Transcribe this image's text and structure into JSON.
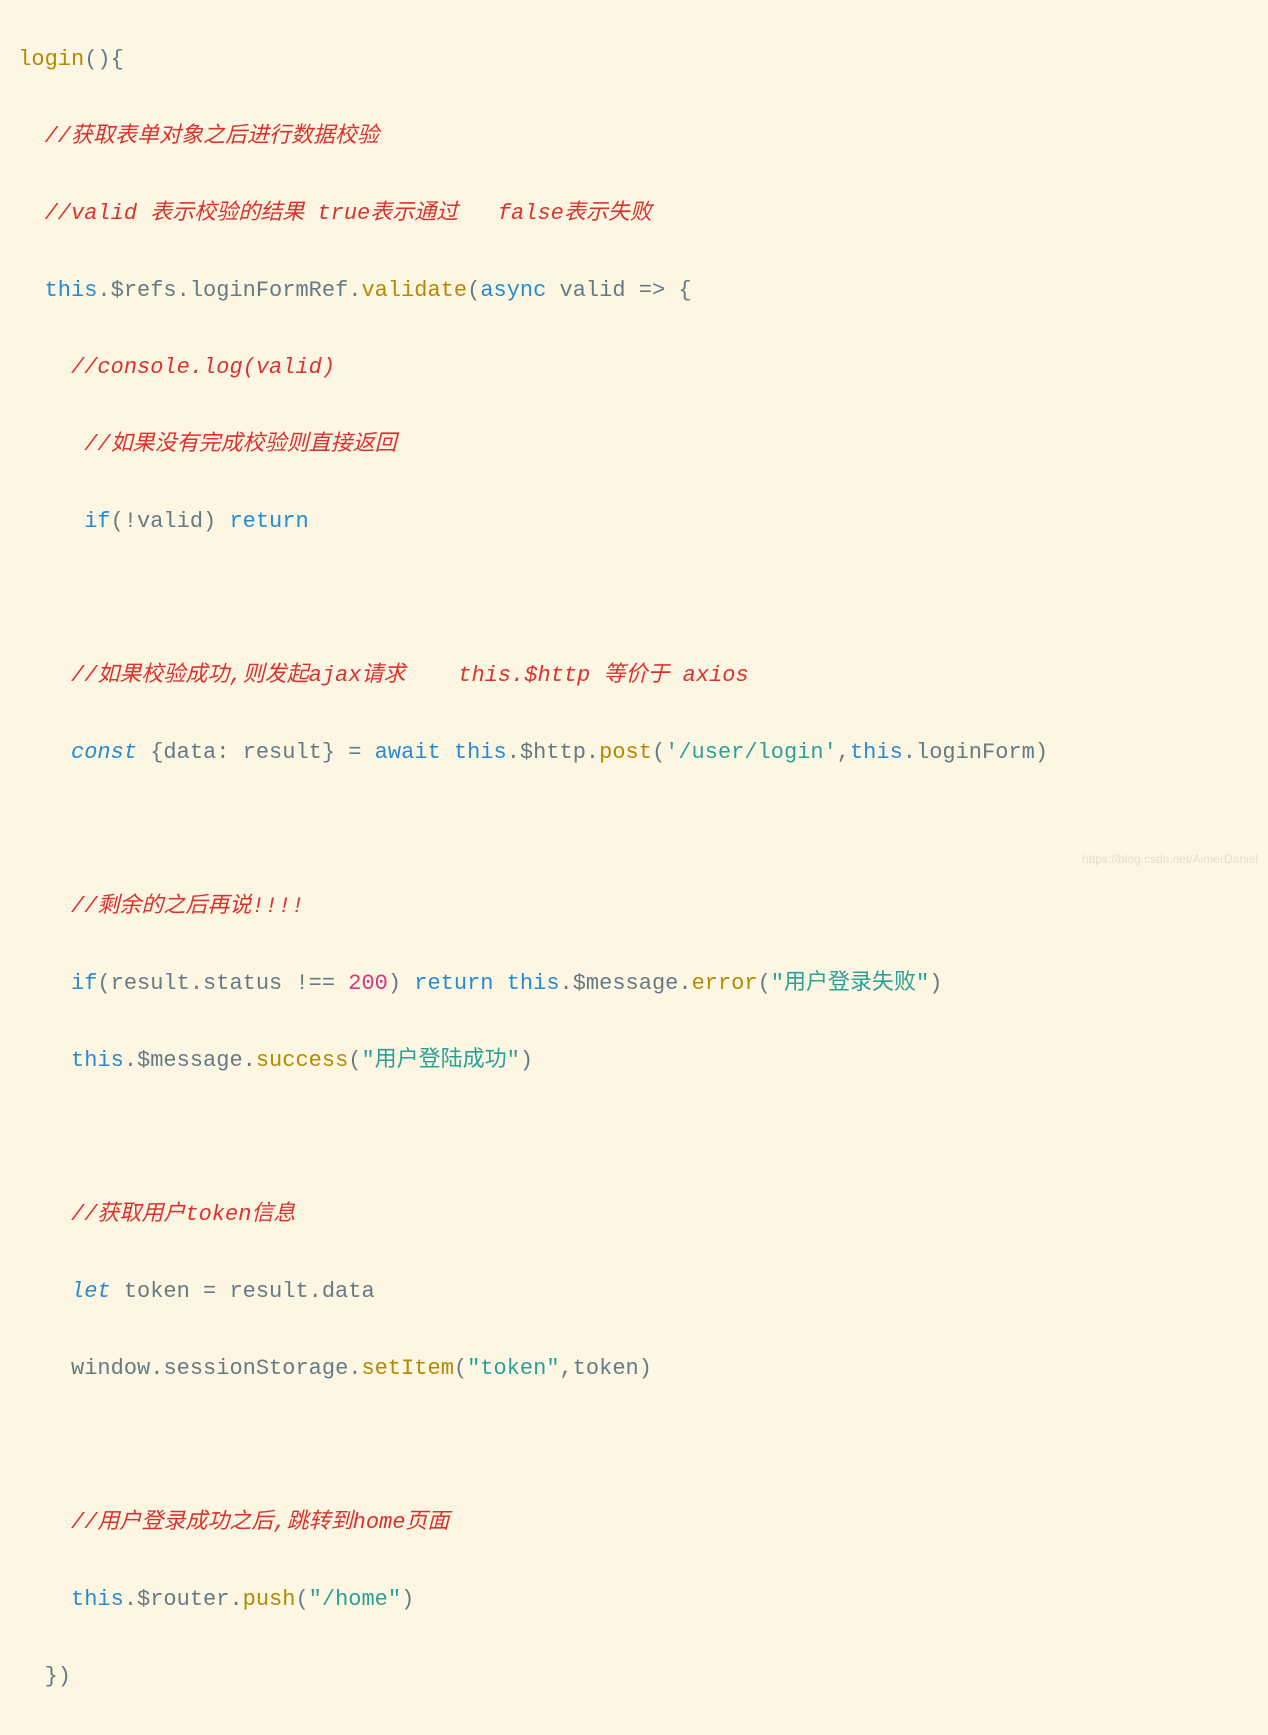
{
  "code": {
    "line1": {
      "func": "login",
      "parens": "(){"
    },
    "line2": {
      "comment": "//获取表单对象之后进行数据校验"
    },
    "line3": {
      "comment": "//valid 表示校验的结果 true表示通过   false表示失败"
    },
    "line4": {
      "this": "this",
      "dot1": ".",
      "refs": "$refs",
      "dot2": ".",
      "loginFormRef": "loginFormRef",
      "dot3": ".",
      "validate": "validate",
      "open": "(",
      "async": "async",
      "valid": " valid ",
      "arrow": "=>",
      "brace": " {"
    },
    "line5": {
      "comment": "//console.log(valid)"
    },
    "line6": {
      "comment": "//如果没有完成校验则直接返回"
    },
    "line7": {
      "if": "if",
      "open": "(!",
      "valid": "valid",
      "close": ") ",
      "return": "return"
    },
    "line8": {
      "blank": ""
    },
    "line9": {
      "comment": "//如果校验成功,则发起ajax请求    this.$http 等价于 axios"
    },
    "line10": {
      "const": "const",
      "destructure": " {data: result} = ",
      "await": "await",
      "space": " ",
      "this": "this",
      "dot": ".",
      "http": "$http",
      "dot2": ".",
      "post": "post",
      "open": "(",
      "url": "'/user/login'",
      "comma": ",",
      "this2": "this",
      "dot3": ".",
      "loginForm": "loginForm",
      "close": ")"
    },
    "line11": {
      "blank": ""
    },
    "line12": {
      "comment": "//剩余的之后再说!!!!"
    },
    "line13": {
      "if": "if",
      "open": "(",
      "result": "result",
      "dot": ".",
      "status": "status",
      "neq": " !== ",
      "num": "200",
      "close": ") ",
      "return": "return",
      "space": " ",
      "this": "this",
      "dot2": ".",
      "message": "$message",
      "dot3": ".",
      "error": "error",
      "open2": "(",
      "str": "\"用户登录失败\"",
      "close2": ")"
    },
    "line14": {
      "this": "this",
      "dot": ".",
      "message": "$message",
      "dot2": ".",
      "success": "success",
      "open": "(",
      "str": "\"用户登陆成功\"",
      "close": ")"
    },
    "line15": {
      "blank": ""
    },
    "line16": {
      "comment": "//获取用户token信息"
    },
    "line17": {
      "let": "let",
      "rest": " token = result.data"
    },
    "line18": {
      "window": "window",
      "dot": ".",
      "sessionStorage": "sessionStorage",
      "dot2": ".",
      "setItem": "setItem",
      "open": "(",
      "str": "\"token\"",
      "comma": ",",
      "token": "token",
      "close": ")"
    },
    "line19": {
      "blank": ""
    },
    "line20": {
      "comment": "//用户登录成功之后,跳转到home页面"
    },
    "line21": {
      "this": "this",
      "dot": ".",
      "router": "$router",
      "dot2": ".",
      "push": "push",
      "open": "(",
      "str": "\"/home\"",
      "close": ")"
    },
    "line22": {
      "close": "})"
    }
  },
  "watermark": "https://blog.csdn.net/AimerDaniel"
}
